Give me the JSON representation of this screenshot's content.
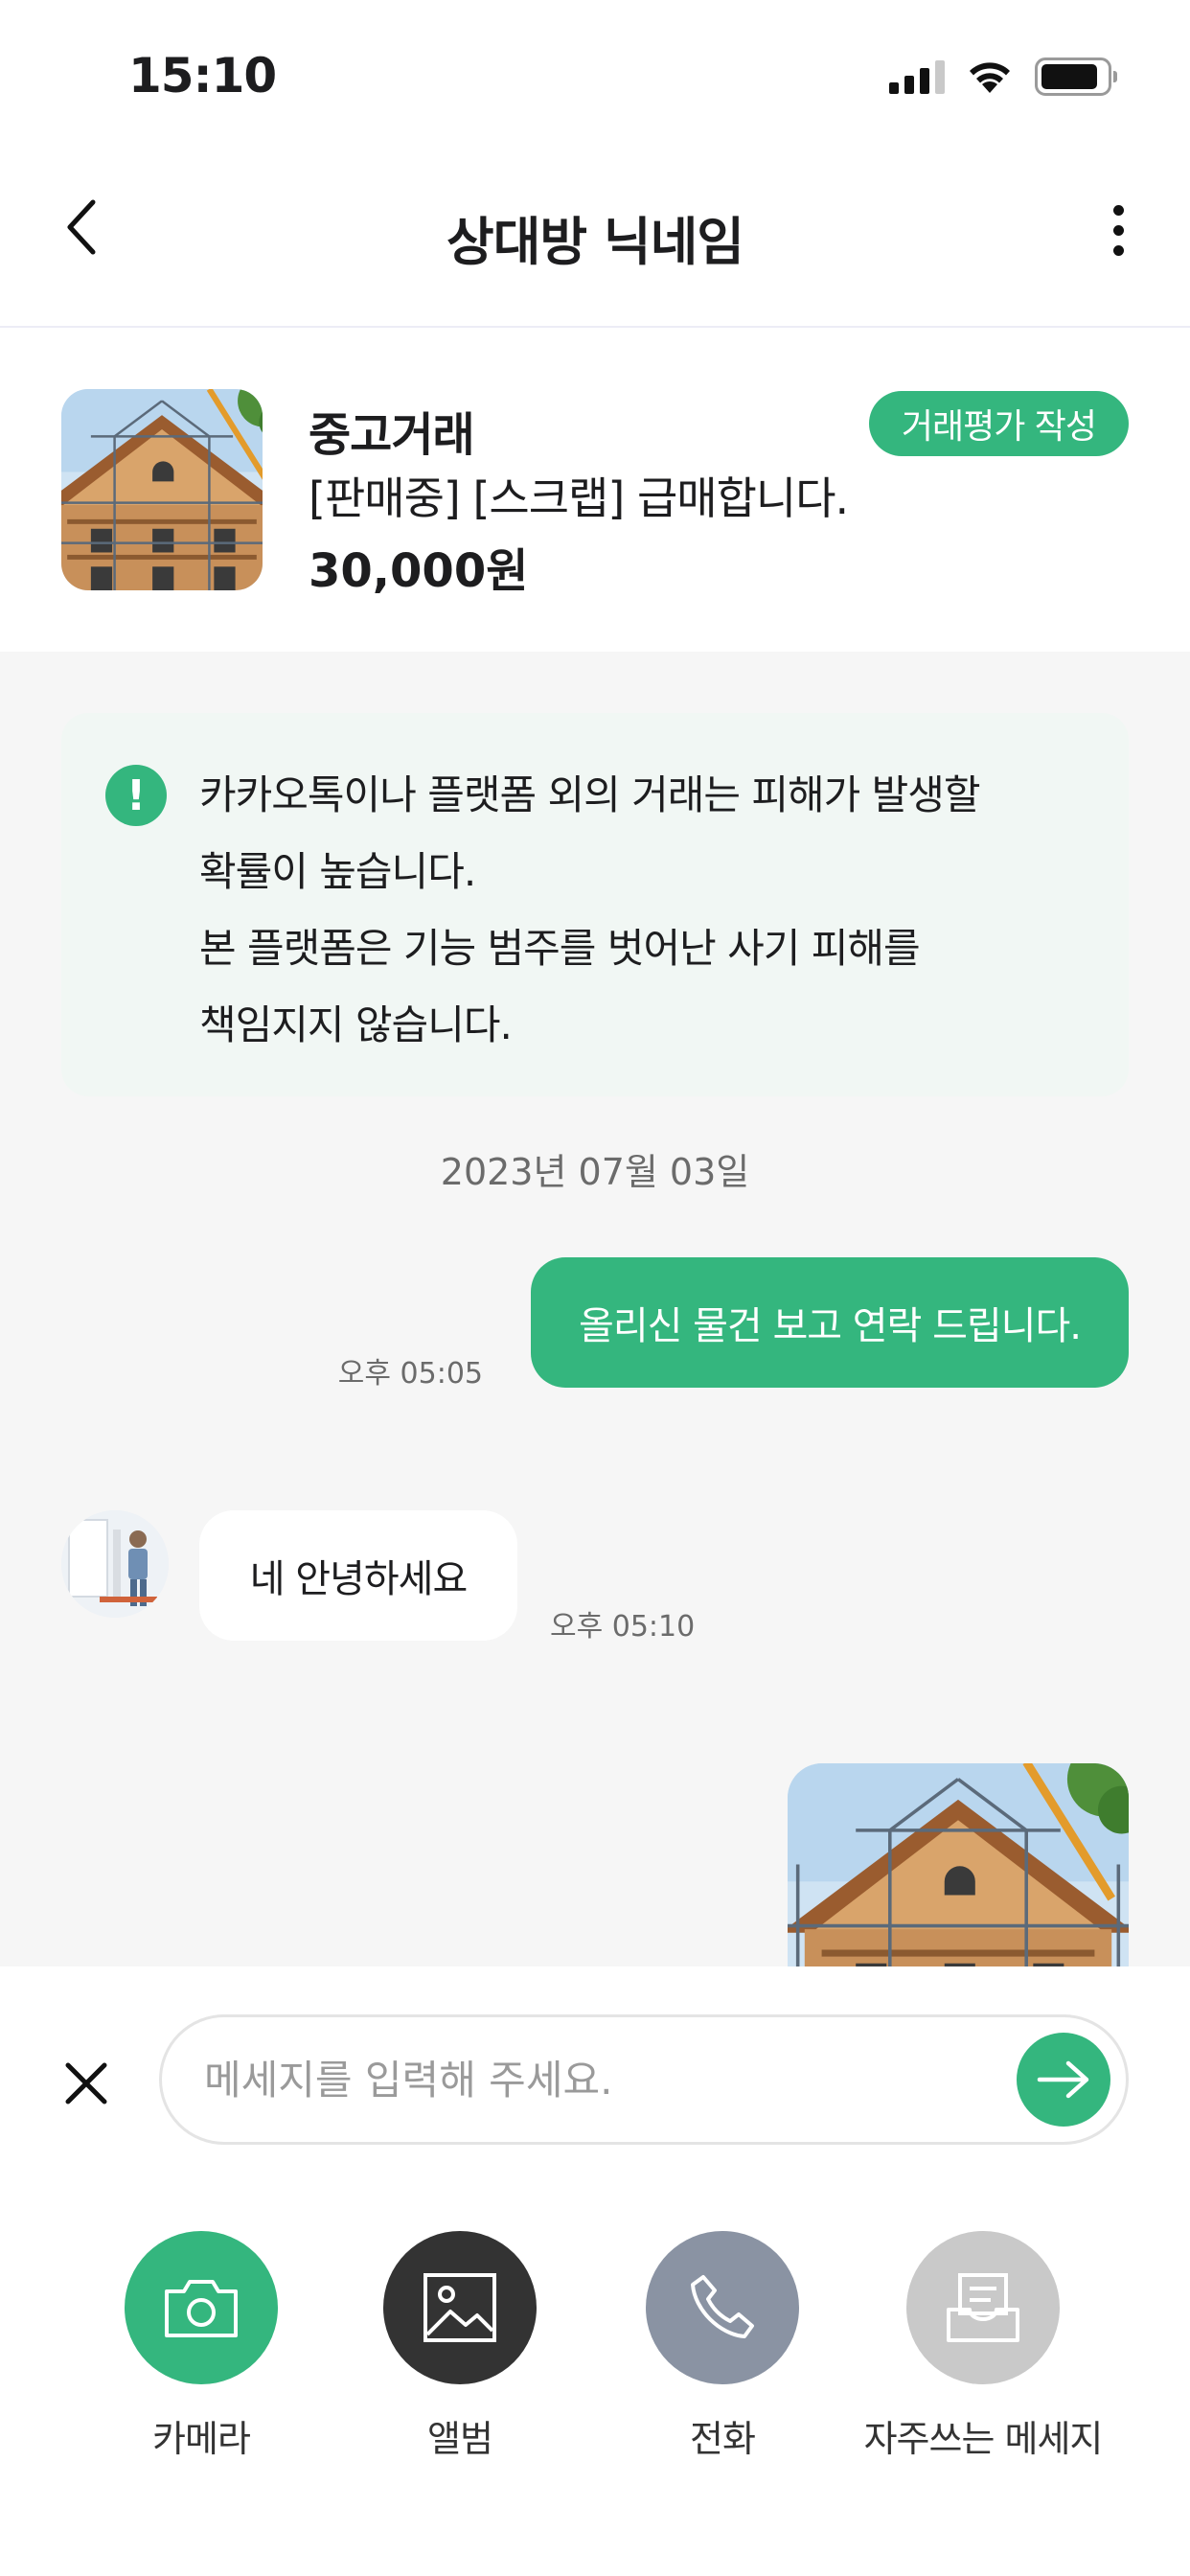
{
  "status_bar": {
    "time": "15:10",
    "battery_level": 0.88
  },
  "header": {
    "title": "상대방 닉네임",
    "back_icon": "chevron-left-icon",
    "more_icon": "more-vertical-icon"
  },
  "product": {
    "category": "중고거래",
    "name": "[판매중] [스크랩] 급매합니다.",
    "price": "30,000원",
    "review_button": "거래평가 작성"
  },
  "notice": {
    "lines": [
      "카카오톡이나 플랫폼 외의 거래는 피해가 발생할",
      "확률이 높습니다.",
      "본 플랫폼은 기능 범주를 벗어난 사기 피해를",
      "책임지지 않습니다."
    ]
  },
  "chat": {
    "date": "2023년 07월 03일",
    "messages": [
      {
        "direction": "out",
        "text": "올리신 물건 보고 연락 드립니다.",
        "time": "오후 05:05"
      },
      {
        "direction": "in",
        "text": "네 안녕하세요",
        "time": "오후 05:10"
      }
    ]
  },
  "composer": {
    "placeholder": "메세지를 입력해 주세요.",
    "value": ""
  },
  "actions": [
    {
      "label": "카메라",
      "icon": "camera-icon",
      "color": "#34b67e"
    },
    {
      "label": "앨범",
      "icon": "image-icon",
      "color": "#333333"
    },
    {
      "label": "전화",
      "icon": "phone-icon",
      "color": "#8a93a3"
    },
    {
      "label": "자주쓰는 메세지",
      "icon": "inbox-icon",
      "color": "#c9c9c9"
    }
  ],
  "colors": {
    "accent": "#34b67e",
    "chat_background": "#f6f6f6",
    "notice_background": "#f1f7f4"
  }
}
